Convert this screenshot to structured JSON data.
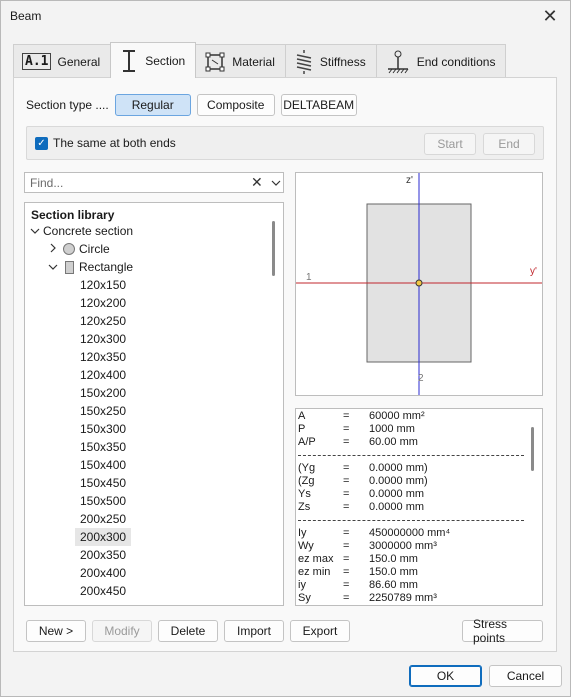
{
  "window": {
    "title": "Beam"
  },
  "tabs": [
    {
      "label": "General",
      "icon": "a1-icon",
      "icon_text": "A.1"
    },
    {
      "label": "Section",
      "icon": "i-beam-icon",
      "active": true
    },
    {
      "label": "Material",
      "icon": "material-icon"
    },
    {
      "label": "Stiffness",
      "icon": "spring-icon"
    },
    {
      "label": "End conditions",
      "icon": "support-icon"
    }
  ],
  "section_type": {
    "label": "Section type ....",
    "options": [
      "Regular",
      "Composite",
      "DELTABEAM"
    ],
    "selected": "Regular"
  },
  "same_ends": {
    "label": "The same at both ends",
    "checked": true,
    "start_label": "Start",
    "end_label": "End"
  },
  "search": {
    "placeholder": "Find...",
    "value": ""
  },
  "library": {
    "header": "Section library",
    "group": "Concrete section",
    "types": [
      "Circle",
      "Rectangle"
    ],
    "sizes": [
      "120x150",
      "120x200",
      "120x250",
      "120x300",
      "120x350",
      "120x400",
      "150x200",
      "150x250",
      "150x300",
      "150x350",
      "150x400",
      "150x450",
      "150x500",
      "200x250",
      "200x300",
      "200x350",
      "200x400",
      "200x450"
    ],
    "selected": "200x300"
  },
  "preview": {
    "z_label": "z'",
    "y_label": "y'",
    "point1": "1",
    "point2": "2",
    "colors": {
      "y_axis": "#c0272d",
      "z_axis": "#2b2bd0",
      "section_fill": "#e2e2e2"
    }
  },
  "properties": {
    "group1": [
      {
        "key": "A",
        "eq": "=",
        "val": "60000 mm²"
      },
      {
        "key": "P",
        "eq": "=",
        "val": "1000 mm"
      },
      {
        "key": "A/P",
        "eq": "=",
        "val": "60.00 mm"
      }
    ],
    "group2": [
      {
        "key": "(Yg",
        "eq": "=",
        "val": "0.0000 mm)"
      },
      {
        "key": "(Zg",
        "eq": "=",
        "val": "0.0000 mm)"
      },
      {
        "key": "Ys",
        "eq": "=",
        "val": "0.0000 mm"
      },
      {
        "key": "Zs",
        "eq": "=",
        "val": "0.0000 mm"
      }
    ],
    "group3": [
      {
        "key": "Iy",
        "eq": "=",
        "val": "450000000 mm⁴"
      },
      {
        "key": "Wy",
        "eq": "=",
        "val": "3000000 mm³"
      },
      {
        "key": "ez max",
        "eq": "=",
        "val": "150.0 mm"
      },
      {
        "key": "ez min",
        "eq": "=",
        "val": "150.0 mm"
      },
      {
        "key": "iy",
        "eq": "=",
        "val": "86.60 mm"
      },
      {
        "key": "Sy",
        "eq": "=",
        "val": "2250789 mm³"
      }
    ]
  },
  "actions": {
    "new": "New >",
    "modify": "Modify",
    "delete": "Delete",
    "import": "Import",
    "export": "Export",
    "stress_points": "Stress points"
  },
  "dialog": {
    "ok": "OK",
    "cancel": "Cancel"
  },
  "colors": {
    "accent": "#0f6cbd",
    "selected_button": "#cfe3f7"
  }
}
